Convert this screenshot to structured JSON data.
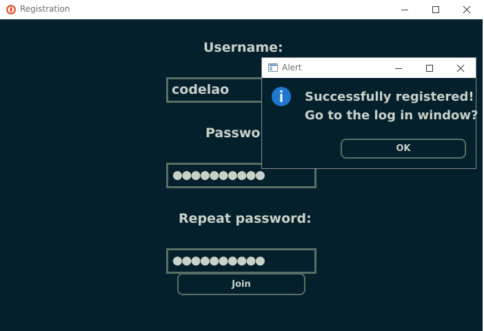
{
  "window": {
    "title": "Registration",
    "app_icon": "flame-logo-icon",
    "controls": [
      "minimize-icon",
      "maximize-icon",
      "close-icon"
    ]
  },
  "form": {
    "username_label": "Username:",
    "username_value": "codelao",
    "password_label": "Password:",
    "password_mask": "●●●●●●●●●●",
    "repeat_password_label": "Repeat password:",
    "repeat_password_mask": "●●●●●●●●●●",
    "join_label": "Join"
  },
  "alert": {
    "title": "Alert",
    "icon": "info-icon",
    "message_line1": "Successfully registered!",
    "message_line2": "Go to the log in window?",
    "ok_label": "OK"
  },
  "colors": {
    "background": "#04202c",
    "text": "#c9d1c8",
    "border": "#5b7065",
    "info_blue": "#1e78d2"
  }
}
